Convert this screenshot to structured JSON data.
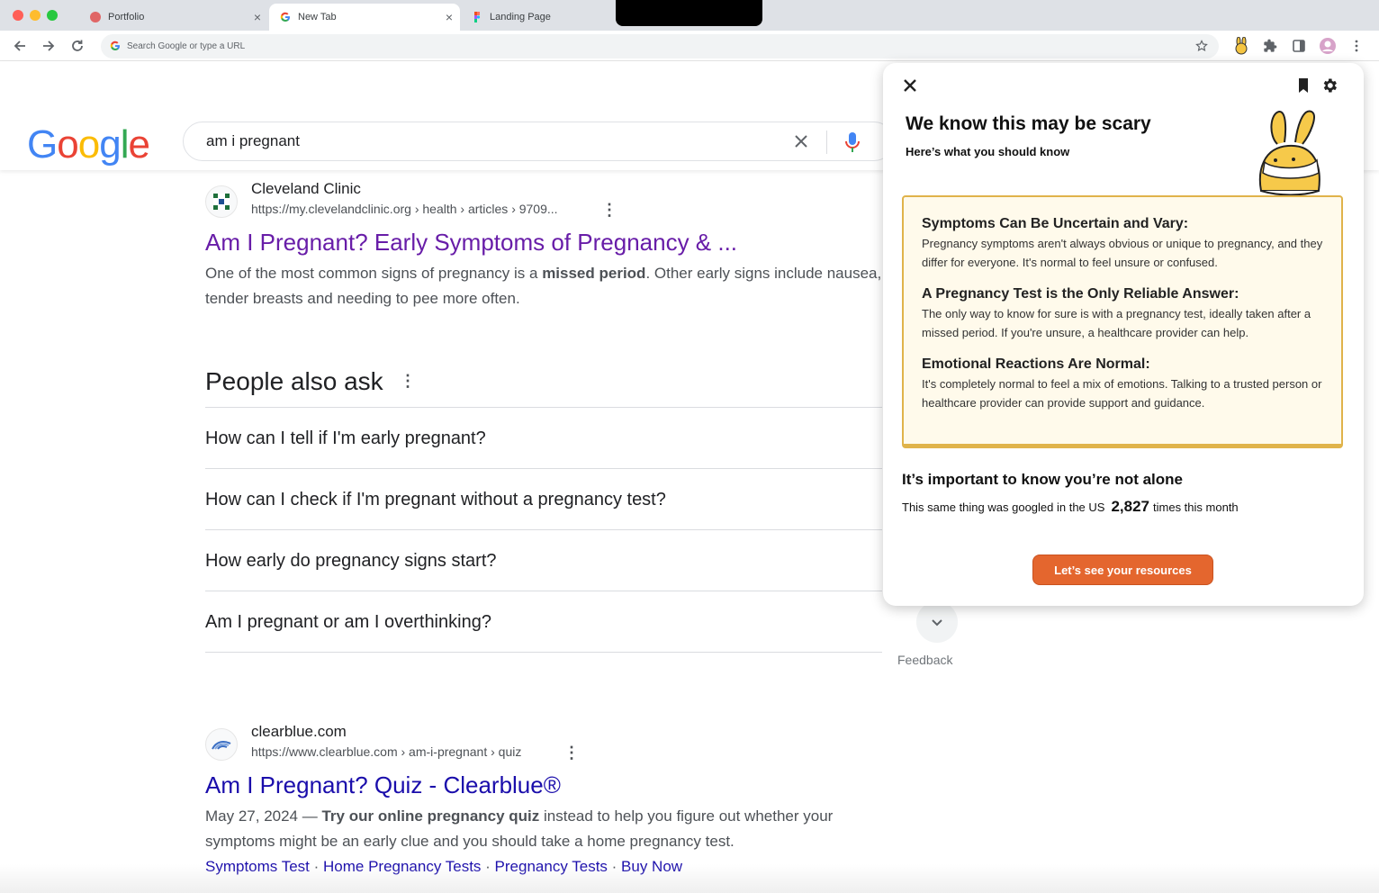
{
  "browser": {
    "tabs": [
      {
        "label": "Portfolio",
        "active": false
      },
      {
        "label": "New Tab",
        "active": true
      },
      {
        "label": "Landing Page",
        "active": false
      }
    ],
    "address_placeholder": "Search Google or type a URL"
  },
  "google": {
    "logo_letters": [
      "G",
      "o",
      "o",
      "g",
      "l",
      "e"
    ],
    "logo_colors": [
      "#4285f4",
      "#ea4335",
      "#fbbc05",
      "#4285f4",
      "#34a853",
      "#ea4335"
    ],
    "query": "am i pregnant"
  },
  "results": [
    {
      "site_name": "Cleveland Clinic",
      "url": "https://my.clevelandclinic.org › health › articles › 9709...",
      "title": "Am I Pregnant? Early Symptoms of Pregnancy & ...",
      "title_color": "#681da8",
      "snippet_pre": "One of the most common signs of pregnancy is a ",
      "snippet_bold": "missed period",
      "snippet_post": ". Other early signs include nausea, tender breasts and needing to pee more often."
    },
    {
      "site_name": "clearblue.com",
      "url": "https://www.clearblue.com › am-i-pregnant › quiz",
      "title": "Am I Pregnant? Quiz - Clearblue®",
      "title_color": "#1a0dab",
      "date": "May 27, 2024 — ",
      "snippet_bold": "Try our online pregnancy quiz",
      "snippet_post": " instead to help you figure out whether your symptoms might be an early clue and you should take a home pregnancy test.",
      "sitelinks": [
        "Symptoms Test",
        "Home Pregnancy Tests",
        "Pregnancy Tests",
        "Buy Now"
      ]
    }
  ],
  "paa": {
    "title": "People also ask",
    "questions": [
      "How can I tell if I'm early pregnant?",
      "How can I check if I'm pregnant without a pregnancy test?",
      "How early do pregnancy signs start?",
      "Am I pregnant or am I overthinking?"
    ]
  },
  "feedback_label": "Feedback",
  "panel": {
    "title": "We know this may be scary",
    "subtitle": "Here’s what you should know",
    "sections": [
      {
        "heading": "Symptoms Can Be Uncertain and Vary:",
        "text": "Pregnancy symptoms aren't always obvious or unique to pregnancy, and they differ for everyone. It's normal to feel unsure or confused."
      },
      {
        "heading": "A Pregnancy Test is the Only Reliable Answer:",
        "text": "The only way to know for sure is with a pregnancy test, ideally taken after a missed period. If you're unsure, a healthcare provider can help."
      },
      {
        "heading": "Emotional Reactions Are Normal:",
        "text": "It's completely normal to feel a mix of emotions. Talking to a trusted person or healthcare provider can provide support and guidance."
      }
    ],
    "alone_heading": "It’s important to know you’re not alone",
    "alone_pre": "This same thing was googled in the US",
    "alone_count": "2,827",
    "alone_post": "times this month",
    "button_label": "Let’s see your resources",
    "accent": "#e4662e",
    "card_border": "#e0b34a"
  }
}
